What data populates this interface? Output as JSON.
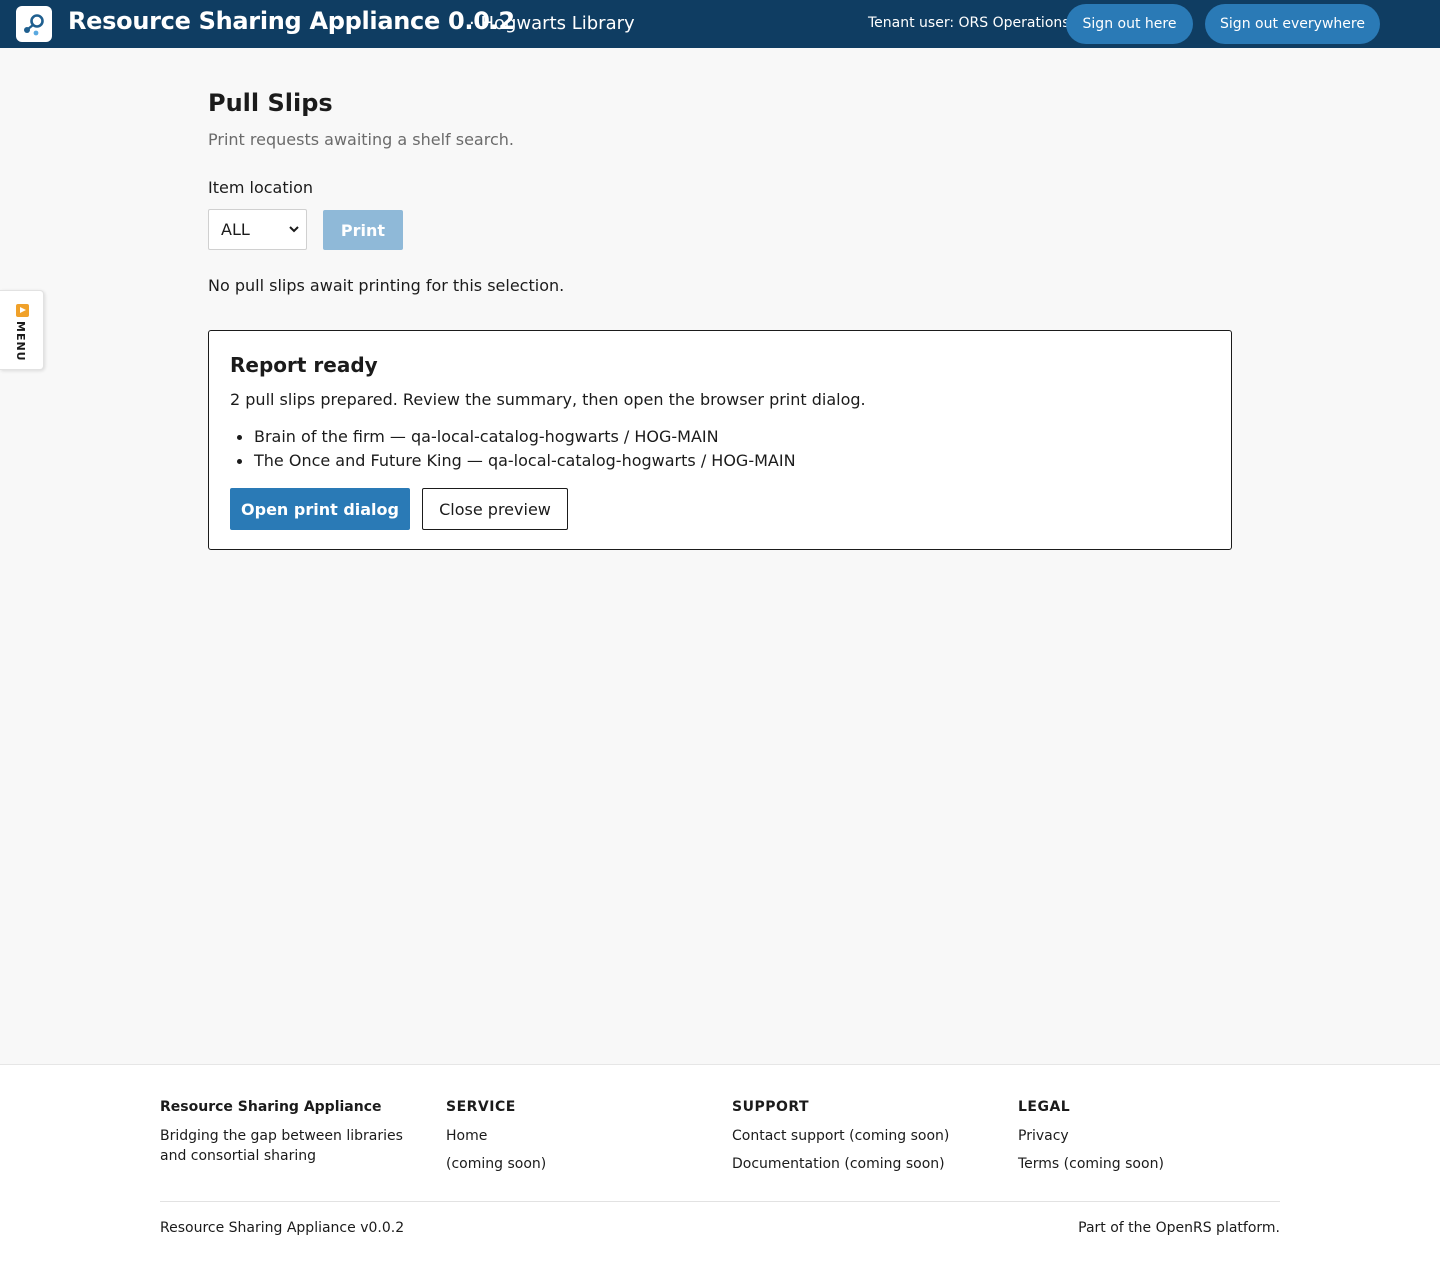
{
  "header": {
    "app_title": "Resource Sharing Appliance 0.0.2",
    "tenant_name": "· Hogwarts Library",
    "tenant_user": "Tenant user: ORS Operations",
    "sign_out_label": "Sign out here",
    "sign_out_everywhere_label": "Sign out everywhere"
  },
  "side_menu": {
    "label": "MENU"
  },
  "main": {
    "title": "Pull Slips",
    "subtitle": "Print requests awaiting a shelf search.",
    "location_label": "Item location",
    "location_selected": "ALL",
    "print_label": "Print",
    "empty_message": "No pull slips await printing for this selection."
  },
  "report": {
    "title": "Report ready",
    "description": "2 pull slips prepared. Review the summary, then open the browser print dialog.",
    "items": [
      "Brain of the firm — qa-local-catalog-hogwarts / HOG-MAIN",
      "The Once and Future King — qa-local-catalog-hogwarts / HOG-MAIN"
    ],
    "open_print_label": "Open print dialog",
    "close_preview_label": "Close preview"
  },
  "footer": {
    "brand": "Resource Sharing Appliance",
    "tagline": "Bridging the gap between libraries and consortial sharing",
    "service_heading": "SERVICE",
    "service_links": [
      "Home",
      "(coming soon)"
    ],
    "support_heading": "SUPPORT",
    "support_links": [
      "Contact support (coming soon)",
      "Documentation (coming soon)"
    ],
    "legal_heading": "LEGAL",
    "legal_links": [
      "Privacy",
      "Terms (coming soon)"
    ],
    "version": "Resource Sharing Appliance v0.0.2",
    "platform": "Part of the OpenRS platform."
  },
  "colors": {
    "header_bg": "#0f3d62",
    "primary": "#2a7ab6",
    "disabled": "#8fb9d8",
    "menu_accent": "#f0a12a"
  },
  "icons": {
    "logo": "share-network-icon",
    "select": "chevron-down-icon",
    "menu": "play-icon"
  }
}
